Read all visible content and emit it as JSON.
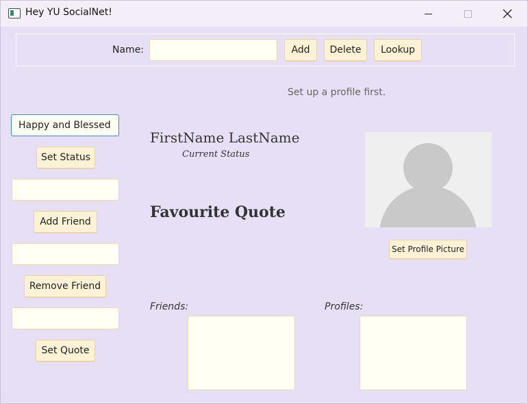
{
  "window": {
    "title": "Hey YU SocialNet!"
  },
  "toolbar": {
    "name_label": "Name:",
    "name_value": "",
    "add_label": "Add",
    "delete_label": "Delete",
    "lookup_label": "Lookup"
  },
  "message": "Set up a profile first.",
  "sidebar": {
    "status_value": "Happy and Blessed",
    "set_status_label": "Set Status",
    "add_friend_value": "",
    "add_friend_label": "Add Friend",
    "remove_friend_value": "",
    "remove_friend_label": "Remove Friend",
    "quote_value": "",
    "set_quote_label": "Set Quote"
  },
  "profile": {
    "full_name": "FirstName LastName",
    "current_status": "Current Status",
    "favourite_quote": "Favourite Quote",
    "set_picture_label": "Set Profile Picture"
  },
  "lists": {
    "friends_label": "Friends:",
    "profiles_label": "Profiles:"
  }
}
